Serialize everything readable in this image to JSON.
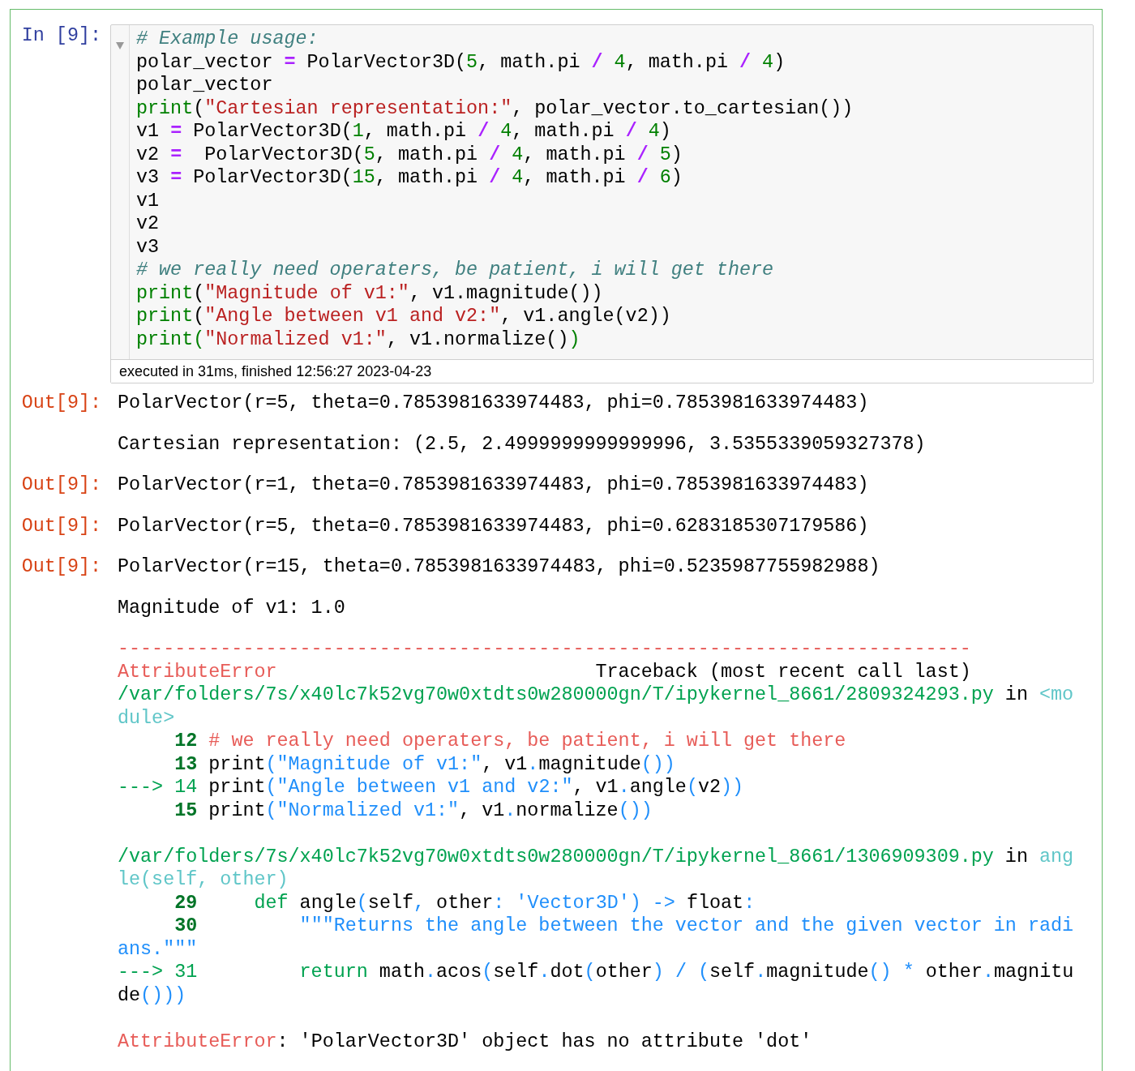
{
  "input_cell": {
    "prompt": "In [9]:",
    "lines": [
      [
        {
          "text": "# Example usage:",
          "kind": "comment"
        }
      ],
      [
        {
          "text": "polar_vector ",
          "kind": "plain"
        },
        {
          "text": "=",
          "kind": "op"
        },
        {
          "text": " PolarVector3D(",
          "kind": "plain"
        },
        {
          "text": "5",
          "kind": "num"
        },
        {
          "text": ", math.pi ",
          "kind": "plain"
        },
        {
          "text": "/ ",
          "kind": "op"
        },
        {
          "text": "4",
          "kind": "num"
        },
        {
          "text": ", math.pi ",
          "kind": "plain"
        },
        {
          "text": "/ ",
          "kind": "op"
        },
        {
          "text": "4",
          "kind": "num"
        },
        {
          "text": ")",
          "kind": "plain"
        }
      ],
      [
        {
          "text": "polar_vector",
          "kind": "plain"
        }
      ],
      [
        {
          "text": "print",
          "kind": "kw"
        },
        {
          "text": "(",
          "kind": "plain"
        },
        {
          "text": "\"Cartesian representation:\"",
          "kind": "str"
        },
        {
          "text": ", polar_vector.to_cartesian())",
          "kind": "plain"
        }
      ],
      [
        {
          "text": "v1 ",
          "kind": "plain"
        },
        {
          "text": "=",
          "kind": "op"
        },
        {
          "text": " PolarVector3D(",
          "kind": "plain"
        },
        {
          "text": "1",
          "kind": "num"
        },
        {
          "text": ", math.pi ",
          "kind": "plain"
        },
        {
          "text": "/ ",
          "kind": "op"
        },
        {
          "text": "4",
          "kind": "num"
        },
        {
          "text": ", math.pi ",
          "kind": "plain"
        },
        {
          "text": "/ ",
          "kind": "op"
        },
        {
          "text": "4",
          "kind": "num"
        },
        {
          "text": ")",
          "kind": "plain"
        }
      ],
      [
        {
          "text": "v2 ",
          "kind": "plain"
        },
        {
          "text": "=",
          "kind": "op"
        },
        {
          "text": "  PolarVector3D(",
          "kind": "plain"
        },
        {
          "text": "5",
          "kind": "num"
        },
        {
          "text": ", math.pi ",
          "kind": "plain"
        },
        {
          "text": "/ ",
          "kind": "op"
        },
        {
          "text": "4",
          "kind": "num"
        },
        {
          "text": ", math.pi ",
          "kind": "plain"
        },
        {
          "text": "/ ",
          "kind": "op"
        },
        {
          "text": "5",
          "kind": "num"
        },
        {
          "text": ")",
          "kind": "plain"
        }
      ],
      [
        {
          "text": "v3 ",
          "kind": "plain"
        },
        {
          "text": "=",
          "kind": "op"
        },
        {
          "text": " PolarVector3D(",
          "kind": "plain"
        },
        {
          "text": "15",
          "kind": "num"
        },
        {
          "text": ", math.pi ",
          "kind": "plain"
        },
        {
          "text": "/ ",
          "kind": "op"
        },
        {
          "text": "4",
          "kind": "num"
        },
        {
          "text": ", math.pi ",
          "kind": "plain"
        },
        {
          "text": "/ ",
          "kind": "op"
        },
        {
          "text": "6",
          "kind": "num"
        },
        {
          "text": ")",
          "kind": "plain"
        }
      ],
      [
        {
          "text": "v1",
          "kind": "plain"
        }
      ],
      [
        {
          "text": "v2",
          "kind": "plain"
        }
      ],
      [
        {
          "text": "v3",
          "kind": "plain"
        }
      ],
      [
        {
          "text": "# we really need operaters, be patient, i will get there",
          "kind": "comment"
        }
      ],
      [
        {
          "text": "print",
          "kind": "kw"
        },
        {
          "text": "(",
          "kind": "plain"
        },
        {
          "text": "\"Magnitude of v1:\"",
          "kind": "str"
        },
        {
          "text": ", v1.magnitude())",
          "kind": "plain"
        }
      ],
      [
        {
          "text": "print",
          "kind": "kw"
        },
        {
          "text": "(",
          "kind": "plain"
        },
        {
          "text": "\"Angle between v1 and v2:\"",
          "kind": "str"
        },
        {
          "text": ", v1.angle(v2))",
          "kind": "plain"
        }
      ],
      [
        {
          "text": "print",
          "kind": "kw"
        },
        {
          "text": "(",
          "kind": "kw"
        },
        {
          "text": "\"Normalized v1:\"",
          "kind": "str"
        },
        {
          "text": ", v1.normalize()",
          "kind": "plain"
        },
        {
          "text": ")",
          "kind": "kw"
        }
      ]
    ],
    "execution_info": "executed in 31ms, finished 12:56:27 2023-04-23"
  },
  "outputs": [
    {
      "kind": "result",
      "prompt": "Out[9]:",
      "sections": [
        [
          [
            {
              "text": "PolarVector(r=5, theta=0.7853981633974483, phi=0.7853981633974483)",
              "kind": "plain"
            }
          ]
        ]
      ]
    },
    {
      "kind": "stream",
      "sections": [
        [
          [
            {
              "text": "Cartesian representation: (2.5, 2.4999999999999996, 3.5355339059327378)",
              "kind": "plain"
            }
          ]
        ]
      ]
    },
    {
      "kind": "result",
      "prompt": "Out[9]:",
      "sections": [
        [
          [
            {
              "text": "PolarVector(r=1, theta=0.7853981633974483, phi=0.7853981633974483)",
              "kind": "plain"
            }
          ]
        ]
      ]
    },
    {
      "kind": "result",
      "prompt": "Out[9]:",
      "sections": [
        [
          [
            {
              "text": "PolarVector(r=5, theta=0.7853981633974483, phi=0.6283185307179586)",
              "kind": "plain"
            }
          ]
        ]
      ]
    },
    {
      "kind": "result",
      "prompt": "Out[9]:",
      "sections": [
        [
          [
            {
              "text": "PolarVector(r=15, theta=0.7853981633974483, phi=0.5235987755982988)",
              "kind": "plain"
            }
          ]
        ]
      ]
    },
    {
      "kind": "stream",
      "sections": [
        [
          [
            {
              "text": "Magnitude of v1: 1.0",
              "kind": "plain"
            }
          ]
        ]
      ]
    },
    {
      "kind": "error",
      "sections": [
        [
          [
            {
              "text": "---------------------------------------------------------------------------",
              "kind": "red"
            }
          ],
          [
            {
              "text": "AttributeError",
              "kind": "red"
            },
            {
              "text": "                            Traceback (most recent call last)",
              "kind": "plain"
            }
          ],
          [
            {
              "text": "/var/folders/7s/x40lc7k52vg70w0xtdts0w280000gn/T/ipykernel_8661/2809324293.py",
              "kind": "green"
            },
            {
              "text": " in ",
              "kind": "plain"
            },
            {
              "text": "<mo",
              "kind": "cyan"
            }
          ],
          [
            {
              "text": "dule>",
              "kind": "cyan"
            }
          ],
          [
            {
              "text": "     12",
              "kind": "lineno"
            },
            {
              "text": " # we really need operaters, be patient, i will get there",
              "kind": "red"
            }
          ],
          [
            {
              "text": "     13",
              "kind": "lineno"
            },
            {
              "text": " print",
              "kind": "plain"
            },
            {
              "text": "(\"Magnitude of v1:\"",
              "kind": "blue"
            },
            {
              "text": ", v1",
              "kind": "plain"
            },
            {
              "text": ".",
              "kind": "blue"
            },
            {
              "text": "magnitude",
              "kind": "plain"
            },
            {
              "text": "())",
              "kind": "blue"
            }
          ],
          [
            {
              "text": "---> 14",
              "kind": "green"
            },
            {
              "text": " print",
              "kind": "plain"
            },
            {
              "text": "(\"Angle between v1 and v2:\"",
              "kind": "blue"
            },
            {
              "text": ", v1",
              "kind": "plain"
            },
            {
              "text": ".",
              "kind": "blue"
            },
            {
              "text": "angle",
              "kind": "plain"
            },
            {
              "text": "(",
              "kind": "blue"
            },
            {
              "text": "v2",
              "kind": "plain"
            },
            {
              "text": "))",
              "kind": "blue"
            }
          ],
          [
            {
              "text": "     15",
              "kind": "lineno"
            },
            {
              "text": " print",
              "kind": "plain"
            },
            {
              "text": "(\"Normalized v1:\"",
              "kind": "blue"
            },
            {
              "text": ", v1",
              "kind": "plain"
            },
            {
              "text": ".",
              "kind": "blue"
            },
            {
              "text": "normalize",
              "kind": "plain"
            },
            {
              "text": "())",
              "kind": "blue"
            }
          ]
        ],
        [
          [
            {
              "text": "/var/folders/7s/x40lc7k52vg70w0xtdts0w280000gn/T/ipykernel_8661/1306909309.py",
              "kind": "green"
            },
            {
              "text": " in ",
              "kind": "plain"
            },
            {
              "text": "ang",
              "kind": "cyan"
            }
          ],
          [
            {
              "text": "le(self, other)",
              "kind": "cyan"
            }
          ],
          [
            {
              "text": "     29     ",
              "kind": "lineno"
            },
            {
              "text": "def",
              "kind": "green"
            },
            {
              "text": " angle",
              "kind": "plain"
            },
            {
              "text": "(",
              "kind": "blue"
            },
            {
              "text": "self",
              "kind": "plain"
            },
            {
              "text": ",",
              "kind": "blue"
            },
            {
              "text": " other",
              "kind": "plain"
            },
            {
              "text": ": 'Vector3D') ->",
              "kind": "blue"
            },
            {
              "text": " float",
              "kind": "plain"
            },
            {
              "text": ":",
              "kind": "blue"
            }
          ],
          [
            {
              "text": "     30         ",
              "kind": "lineno"
            },
            {
              "text": "\"\"\"Returns the angle between the vector and the given vector in radi",
              "kind": "blue"
            }
          ],
          [
            {
              "text": "ans.\"\"\"",
              "kind": "blue"
            }
          ],
          [
            {
              "text": "---> 31         return",
              "kind": "green"
            },
            {
              "text": " math",
              "kind": "plain"
            },
            {
              "text": ".",
              "kind": "blue"
            },
            {
              "text": "acos",
              "kind": "plain"
            },
            {
              "text": "(",
              "kind": "blue"
            },
            {
              "text": "self",
              "kind": "plain"
            },
            {
              "text": ".",
              "kind": "blue"
            },
            {
              "text": "dot",
              "kind": "plain"
            },
            {
              "text": "(",
              "kind": "blue"
            },
            {
              "text": "other",
              "kind": "plain"
            },
            {
              "text": ") / (",
              "kind": "blue"
            },
            {
              "text": "self",
              "kind": "plain"
            },
            {
              "text": ".",
              "kind": "blue"
            },
            {
              "text": "magnitude",
              "kind": "plain"
            },
            {
              "text": "() *",
              "kind": "blue"
            },
            {
              "text": " other",
              "kind": "plain"
            },
            {
              "text": ".",
              "kind": "blue"
            },
            {
              "text": "magnitu",
              "kind": "plain"
            }
          ],
          [
            {
              "text": "de",
              "kind": "plain"
            },
            {
              "text": "()))",
              "kind": "blue"
            }
          ]
        ],
        [
          [
            {
              "text": "AttributeError",
              "kind": "red"
            },
            {
              "text": ": 'PolarVector3D' object has no attribute 'dot'",
              "kind": "plain"
            }
          ]
        ]
      ]
    }
  ]
}
